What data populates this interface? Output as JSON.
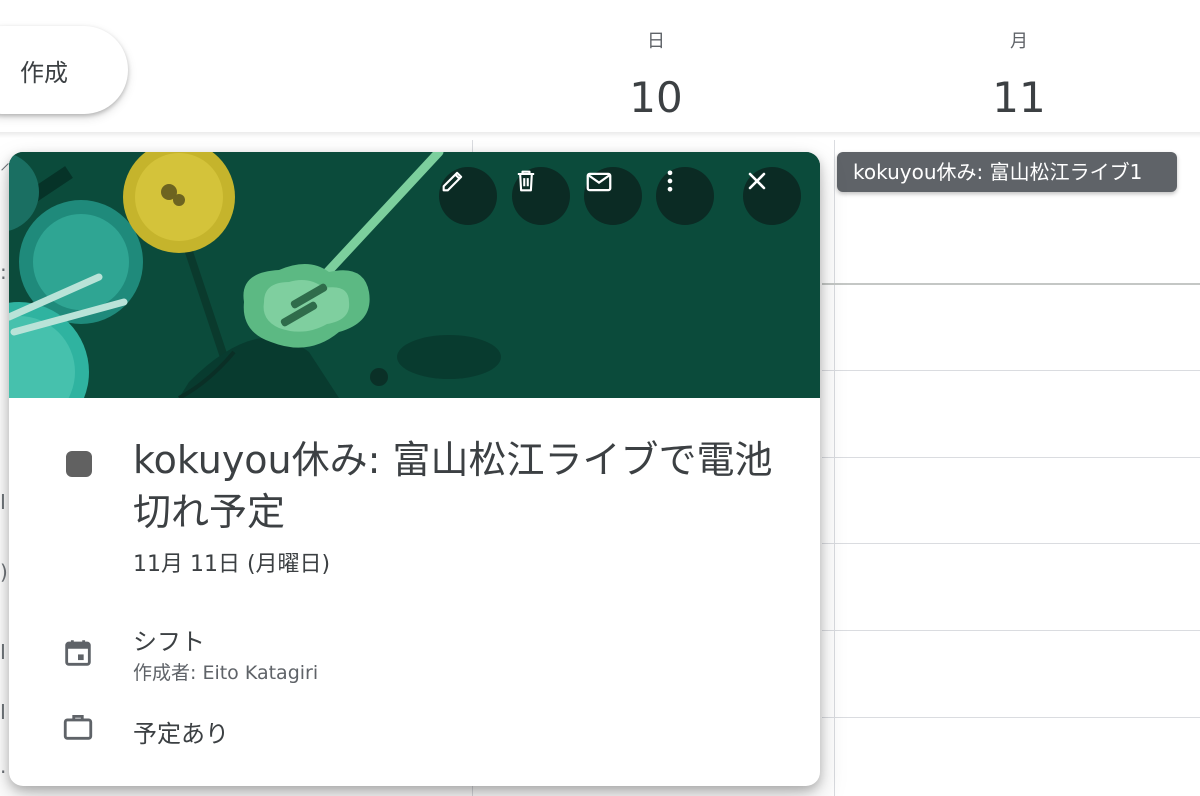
{
  "header": {
    "create_label": "作成",
    "days": [
      {
        "dow": "日",
        "date": "10"
      },
      {
        "dow": "月",
        "date": "11"
      }
    ]
  },
  "tooltip": {
    "text": "kokuyou休み: 富山松江ライブ1"
  },
  "popup": {
    "toolbar": {
      "edit_icon": "pencil-icon",
      "delete_icon": "trash-icon",
      "email_icon": "mail-icon",
      "more_icon": "more-vert-icon",
      "close_icon": "close-icon"
    },
    "event_color": "#616161",
    "title": "kokuyou休み: 富山松江ライブで電池切れ予定",
    "date": "11月 11日 (月曜日)",
    "calendar_name": "シフト",
    "created_by": "作成者: Eito Katagiri",
    "availability": "予定あり"
  },
  "colors": {
    "banner_bg": "#0b4b3b",
    "toolbar_button_bg": "#0b2b24",
    "tooltip_bg": "#5f6368"
  }
}
